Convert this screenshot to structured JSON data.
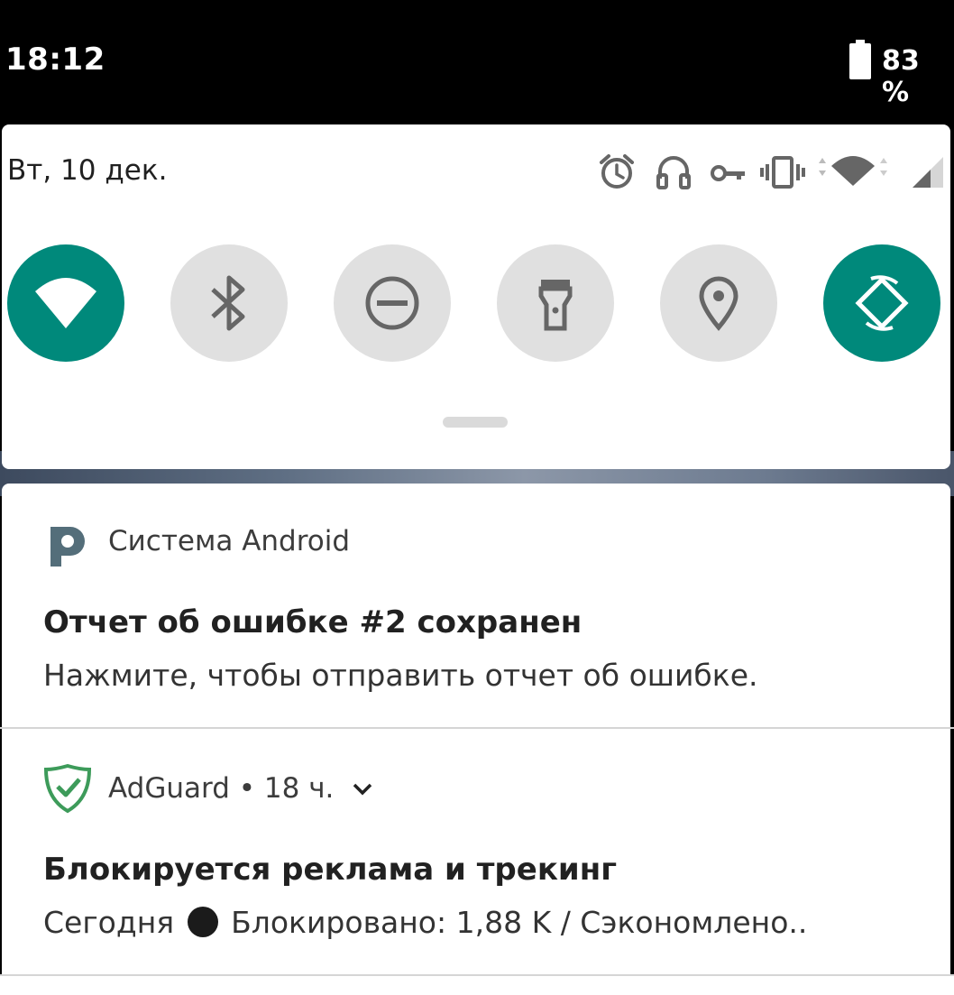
{
  "status_bar": {
    "time": "18:12",
    "battery": "83 %",
    "battery_icon": "battery-icon"
  },
  "quick_settings": {
    "date": "Вт, 10 дек.",
    "status_icons": [
      "alarm-icon",
      "headset-icon",
      "vpn-key-icon",
      "vibrate-icon",
      "wifi-signal-icon",
      "cell-signal-icon"
    ],
    "tiles": [
      {
        "name": "wifi",
        "icon": "wifi-icon",
        "active": true
      },
      {
        "name": "bluetooth",
        "icon": "bluetooth-icon",
        "active": false
      },
      {
        "name": "do-not-disturb",
        "icon": "do-not-disturb-icon",
        "active": false
      },
      {
        "name": "flashlight",
        "icon": "flashlight-icon",
        "active": false
      },
      {
        "name": "location",
        "icon": "location-icon",
        "active": false
      },
      {
        "name": "auto-rotate",
        "icon": "auto-rotate-icon",
        "active": true
      }
    ],
    "accent_color": "#00897b",
    "inactive_color": "#e0e0e0"
  },
  "notifications": [
    {
      "app": "Система Android",
      "icon": "android-system-icon",
      "title": "Отчет об ошибке #2 сохранен",
      "text": "Нажмите, чтобы отправить отчет об ошибке."
    },
    {
      "app": "AdGuard",
      "time": "• 18 ч.",
      "icon": "adguard-shield-icon",
      "title": "Блокируется реклама и трекинг",
      "text_prefix": "Сегодня",
      "text_suffix": "Блокировано: 1,88 K / Сэкономлено.."
    }
  ]
}
